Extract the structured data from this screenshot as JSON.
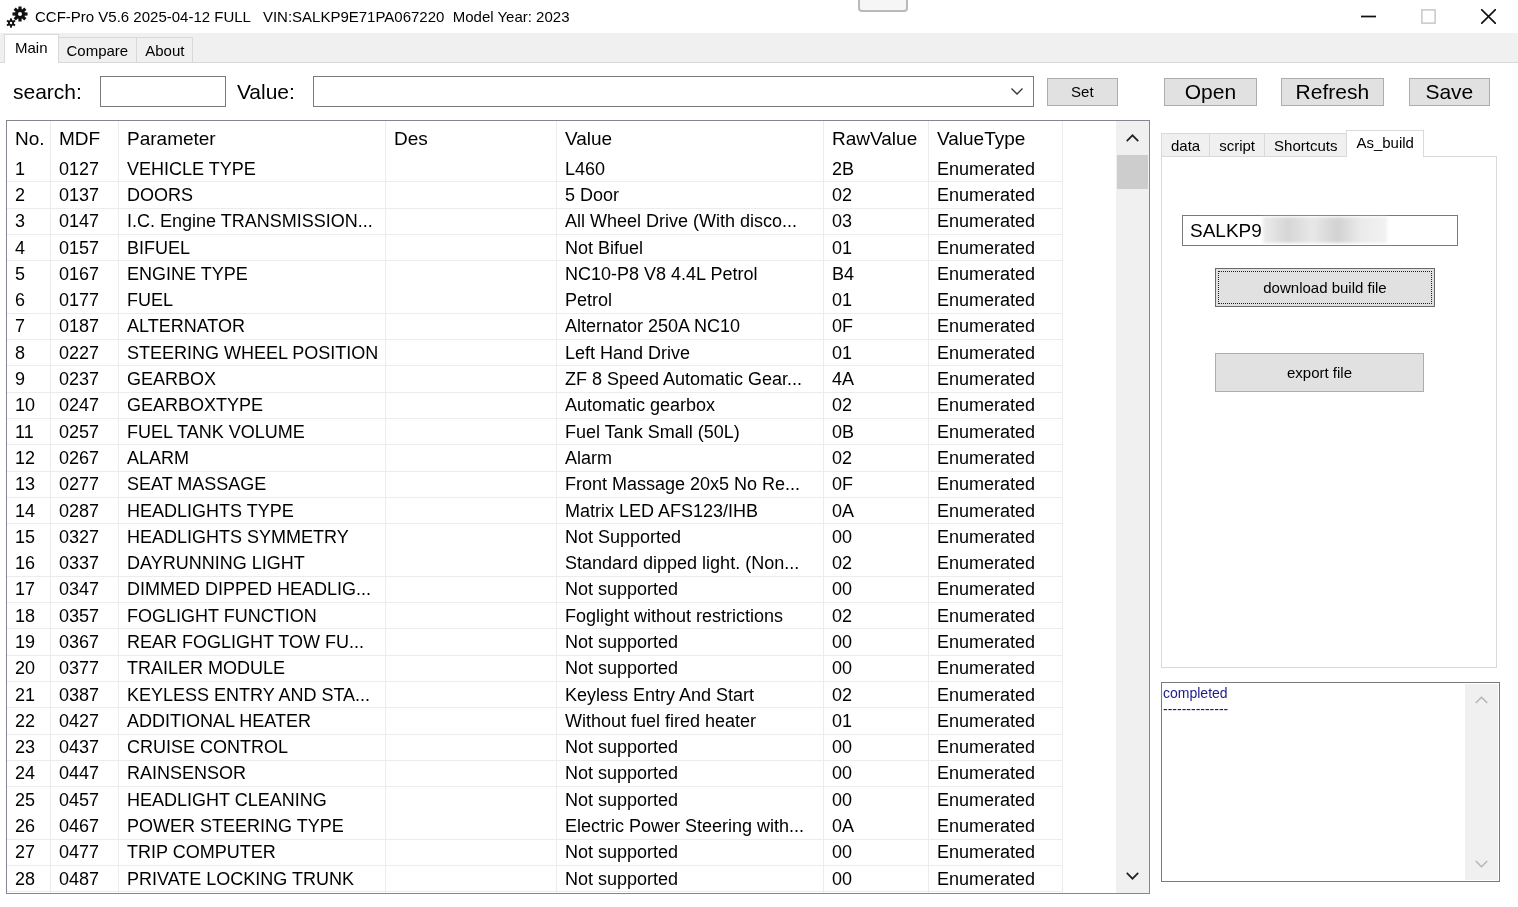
{
  "window": {
    "title": "CCF-Pro V5.6 2025-04-12 FULL   VIN:SALKP9E71PA067220  Model Year: 2023"
  },
  "window_controls": [
    {
      "kind": "minimize",
      "disabled": false
    },
    {
      "kind": "maximize",
      "disabled": true
    },
    {
      "kind": "close",
      "disabled": false
    }
  ],
  "tabs": [
    {
      "label": "Main",
      "selected": true
    },
    {
      "label": "Compare",
      "selected": false
    },
    {
      "label": "About",
      "selected": false
    }
  ],
  "search": {
    "label": "search:"
  },
  "value_field": {
    "label": "Value:"
  },
  "set_button": {
    "label": "Set"
  },
  "file_buttons": [
    {
      "label": "Open"
    },
    {
      "label": "Refresh"
    },
    {
      "label": "Save"
    }
  ],
  "table": {
    "columns": [
      "No.",
      "MDF",
      "Parameter",
      "Des",
      "Value",
      "RawValue",
      "ValueType"
    ],
    "rows": [
      {
        "no": "1",
        "mdf": "0127",
        "parameter": "VEHICLE TYPE",
        "value": "L460",
        "raw_value": "2B",
        "value_type": "Enumerated"
      },
      {
        "no": "2",
        "mdf": "0137",
        "parameter": "DOORS",
        "value": "5 Door",
        "raw_value": "02",
        "value_type": "Enumerated"
      },
      {
        "no": "3",
        "mdf": "0147",
        "parameter": "I.C. Engine TRANSMISSION...",
        "value": "All Wheel Drive (With disco...",
        "raw_value": "03",
        "value_type": "Enumerated"
      },
      {
        "no": "4",
        "mdf": "0157",
        "parameter": "BIFUEL",
        "value": "Not Bifuel",
        "raw_value": "01",
        "value_type": "Enumerated"
      },
      {
        "no": "5",
        "mdf": "0167",
        "parameter": "ENGINE TYPE",
        "value": "NC10-P8 V8 4.4L Petrol",
        "raw_value": "B4",
        "value_type": "Enumerated"
      },
      {
        "no": "6",
        "mdf": "0177",
        "parameter": "FUEL",
        "value": "Petrol",
        "raw_value": "01",
        "value_type": "Enumerated"
      },
      {
        "no": "7",
        "mdf": "0187",
        "parameter": "ALTERNATOR",
        "value": "Alternator 250A NC10",
        "raw_value": "0F",
        "value_type": "Enumerated"
      },
      {
        "no": "8",
        "mdf": "0227",
        "parameter": "STEERING WHEEL POSITION",
        "value": "Left Hand Drive",
        "raw_value": "01",
        "value_type": "Enumerated"
      },
      {
        "no": "9",
        "mdf": "0237",
        "parameter": "GEARBOX",
        "value": "ZF 8 Speed Automatic Gear...",
        "raw_value": "4A",
        "value_type": "Enumerated"
      },
      {
        "no": "10",
        "mdf": "0247",
        "parameter": "GEARBOXTYPE",
        "value": "Automatic gearbox",
        "raw_value": "02",
        "value_type": "Enumerated"
      },
      {
        "no": "11",
        "mdf": "0257",
        "parameter": "FUEL TANK VOLUME",
        "value": "Fuel Tank Small (50L)",
        "raw_value": "0B",
        "value_type": "Enumerated"
      },
      {
        "no": "12",
        "mdf": "0267",
        "parameter": "ALARM",
        "value": "Alarm",
        "raw_value": "02",
        "value_type": "Enumerated"
      },
      {
        "no": "13",
        "mdf": "0277",
        "parameter": "SEAT MASSAGE",
        "value": "Front Massage 20x5 No Re...",
        "raw_value": "0F",
        "value_type": "Enumerated"
      },
      {
        "no": "14",
        "mdf": "0287",
        "parameter": "HEADLIGHTS TYPE",
        "value": "Matrix LED AFS123/IHB",
        "raw_value": "0A",
        "value_type": "Enumerated"
      },
      {
        "no": "15",
        "mdf": "0327",
        "parameter": "HEADLIGHTS SYMMETRY",
        "value": "Not Supported",
        "raw_value": "00",
        "value_type": "Enumerated"
      },
      {
        "no": "16",
        "mdf": "0337",
        "parameter": "DAYRUNNING LIGHT",
        "value": "Standard dipped light. (Non...",
        "raw_value": "02",
        "value_type": "Enumerated"
      },
      {
        "no": "17",
        "mdf": "0347",
        "parameter": "DIMMED DIPPED HEADLIG...",
        "value": "Not supported",
        "raw_value": "00",
        "value_type": "Enumerated"
      },
      {
        "no": "18",
        "mdf": "0357",
        "parameter": "FOGLIGHT FUNCTION",
        "value": "Foglight without restrictions",
        "raw_value": "02",
        "value_type": "Enumerated"
      },
      {
        "no": "19",
        "mdf": "0367",
        "parameter": "REAR FOGLIGHT TOW FU...",
        "value": "Not supported",
        "raw_value": "00",
        "value_type": "Enumerated"
      },
      {
        "no": "20",
        "mdf": "0377",
        "parameter": "TRAILER MODULE",
        "value": "Not supported",
        "raw_value": "00",
        "value_type": "Enumerated"
      },
      {
        "no": "21",
        "mdf": "0387",
        "parameter": "KEYLESS ENTRY AND STA...",
        "value": "Keyless Entry And Start",
        "raw_value": "02",
        "value_type": "Enumerated"
      },
      {
        "no": "22",
        "mdf": "0427",
        "parameter": "ADDITIONAL HEATER",
        "value": "Without fuel fired heater",
        "raw_value": "01",
        "value_type": "Enumerated"
      },
      {
        "no": "23",
        "mdf": "0437",
        "parameter": "CRUISE CONTROL",
        "value": "Not supported",
        "raw_value": "00",
        "value_type": "Enumerated"
      },
      {
        "no": "24",
        "mdf": "0447",
        "parameter": "RAINSENSOR",
        "value": "Not supported",
        "raw_value": "00",
        "value_type": "Enumerated"
      },
      {
        "no": "25",
        "mdf": "0457",
        "parameter": "HEADLIGHT CLEANING",
        "value": "Not supported",
        "raw_value": "00",
        "value_type": "Enumerated"
      },
      {
        "no": "26",
        "mdf": "0467",
        "parameter": "POWER STEERING TYPE",
        "value": "Electric Power Steering with...",
        "raw_value": "0A",
        "value_type": "Enumerated"
      },
      {
        "no": "27",
        "mdf": "0477",
        "parameter": "TRIP COMPUTER",
        "value": "Not supported",
        "raw_value": "00",
        "value_type": "Enumerated"
      },
      {
        "no": "28",
        "mdf": "0487",
        "parameter": "PRIVATE LOCKING TRUNK",
        "value": "Not supported",
        "raw_value": "00",
        "value_type": "Enumerated"
      }
    ]
  },
  "side_tabs": [
    {
      "label": "data",
      "selected": false
    },
    {
      "label": "script",
      "selected": false
    },
    {
      "label": "Shortcuts",
      "selected": false
    },
    {
      "label": "As_build",
      "selected": true
    }
  ],
  "as_build": {
    "vin_value": "SALKP9",
    "buttons": [
      {
        "label": "download build file",
        "focused": true
      },
      {
        "label": "export file",
        "focused": false
      }
    ]
  },
  "log": {
    "lines": [
      "completed",
      "--------------"
    ]
  }
}
